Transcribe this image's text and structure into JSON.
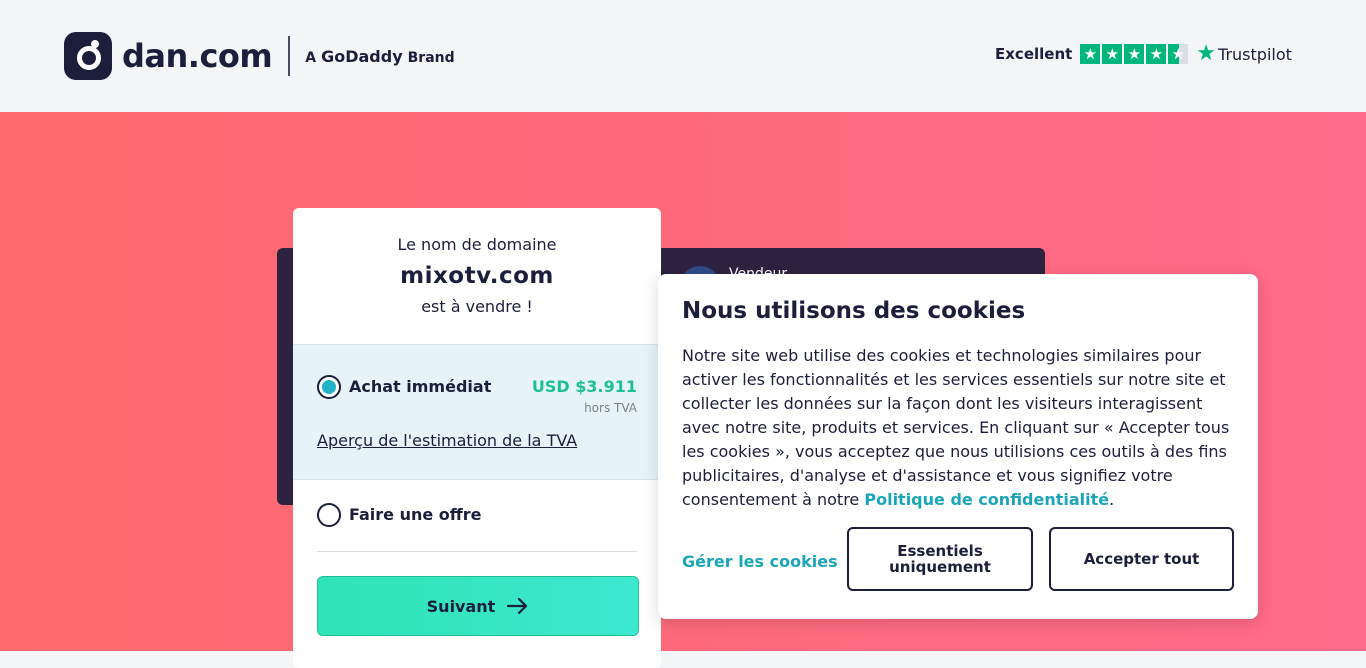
{
  "header": {
    "logo_text": "dan.com",
    "brand_prefix": "A",
    "brand_name": "GoDaddy",
    "brand_suffix": "Brand",
    "trustpilot_rating": "Excellent",
    "trustpilot_name": "Trustpilot",
    "trustpilot_stars": 4.5
  },
  "vendor": {
    "label": "Vendeur"
  },
  "card": {
    "pre_text": "Le nom de domaine",
    "domain": "mixotv.com",
    "post_text": "est à vendre !",
    "buy_label": "Achat immédiat",
    "price": "USD $3.911",
    "vat_note": "hors TVA",
    "vat_link": "Aperçu de l'estimation de la TVA",
    "offer_label": "Faire une offre",
    "next_button": "Suivant"
  },
  "cookies": {
    "title": "Nous utilisons des cookies",
    "body": "Notre site web utilise des cookies et technologies similaires pour activer les fonctionnalités et les services essentiels sur notre site et collecter les données sur la façon dont les visiteurs interagissent avec notre site, produits et services. En cliquant sur « Accepter tous les cookies », vous acceptez que nous utilisions ces outils à des fins publicitaires, d'analyse et d'assistance et vous signifiez votre consentement à notre",
    "privacy_link": "Politique de confidentialité",
    "body_end": ".",
    "manage_link": "Gérer les cookies",
    "essentials_button": "Essentiels uniquement",
    "accept_button": "Accepter tout"
  },
  "colors": {
    "accent_teal": "#1ba6b7",
    "price_green": "#1fbf95",
    "trustpilot_green": "#00b67a",
    "hero_start": "#fe6a6e",
    "hero_end": "#ff6b8a"
  }
}
